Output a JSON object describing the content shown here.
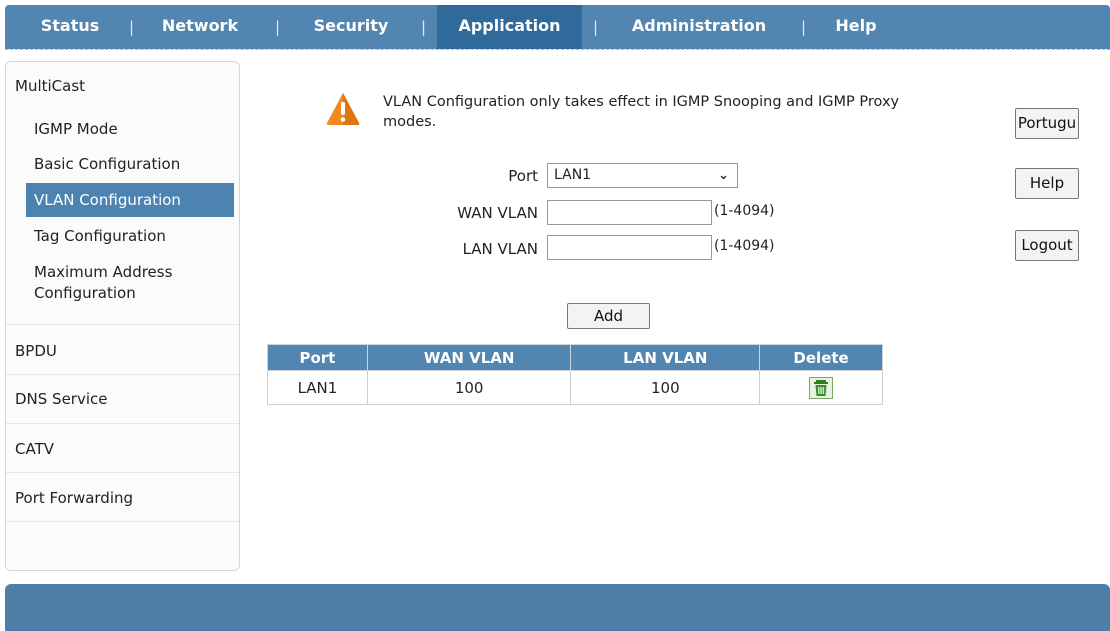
{
  "nav": {
    "items": [
      "Status",
      "Network",
      "Security",
      "Application",
      "Administration",
      "Help"
    ],
    "active": "Application",
    "separator": "|"
  },
  "sidebar": {
    "group_multicast": "MultiCast",
    "sub_items": [
      "IGMP Mode",
      "Basic Configuration",
      "VLAN Configuration",
      "Tag Configuration",
      "Maximum Address Configuration"
    ],
    "active_sub": "VLAN Configuration",
    "group_bpdu": "BPDU",
    "group_dns": "DNS Service",
    "group_catv": "CATV",
    "group_port_forwarding": "Port Forwarding"
  },
  "notice": "VLAN Configuration only takes effect in IGMP Snooping and IGMP Proxy modes.",
  "form": {
    "port_label": "Port",
    "port_value": "LAN1",
    "wan_vlan_label": "WAN VLAN",
    "wan_vlan_value": "",
    "wan_vlan_hint": "(1-4094)",
    "lan_vlan_label": "LAN VLAN",
    "lan_vlan_value": "",
    "lan_vlan_hint": "(1-4094)",
    "add_label": "Add"
  },
  "table": {
    "headers": [
      "Port",
      "WAN VLAN",
      "LAN VLAN",
      "Delete"
    ],
    "rows": [
      {
        "port": "LAN1",
        "wan_vlan": "100",
        "lan_vlan": "100"
      }
    ]
  },
  "right_buttons": {
    "language": "Portugu",
    "help": "Help",
    "logout": "Logout"
  },
  "colors": {
    "nav_bg": "#5285b0",
    "nav_active": "#2f6a9a",
    "accent": "#4d83b1",
    "footer": "#4f7fa6",
    "warning": "#f08a1c",
    "trash": "#3a8c2a"
  },
  "icons": {
    "warning": "warning-triangle-icon",
    "delete": "trash-icon",
    "select": "chevron-down-icon"
  }
}
